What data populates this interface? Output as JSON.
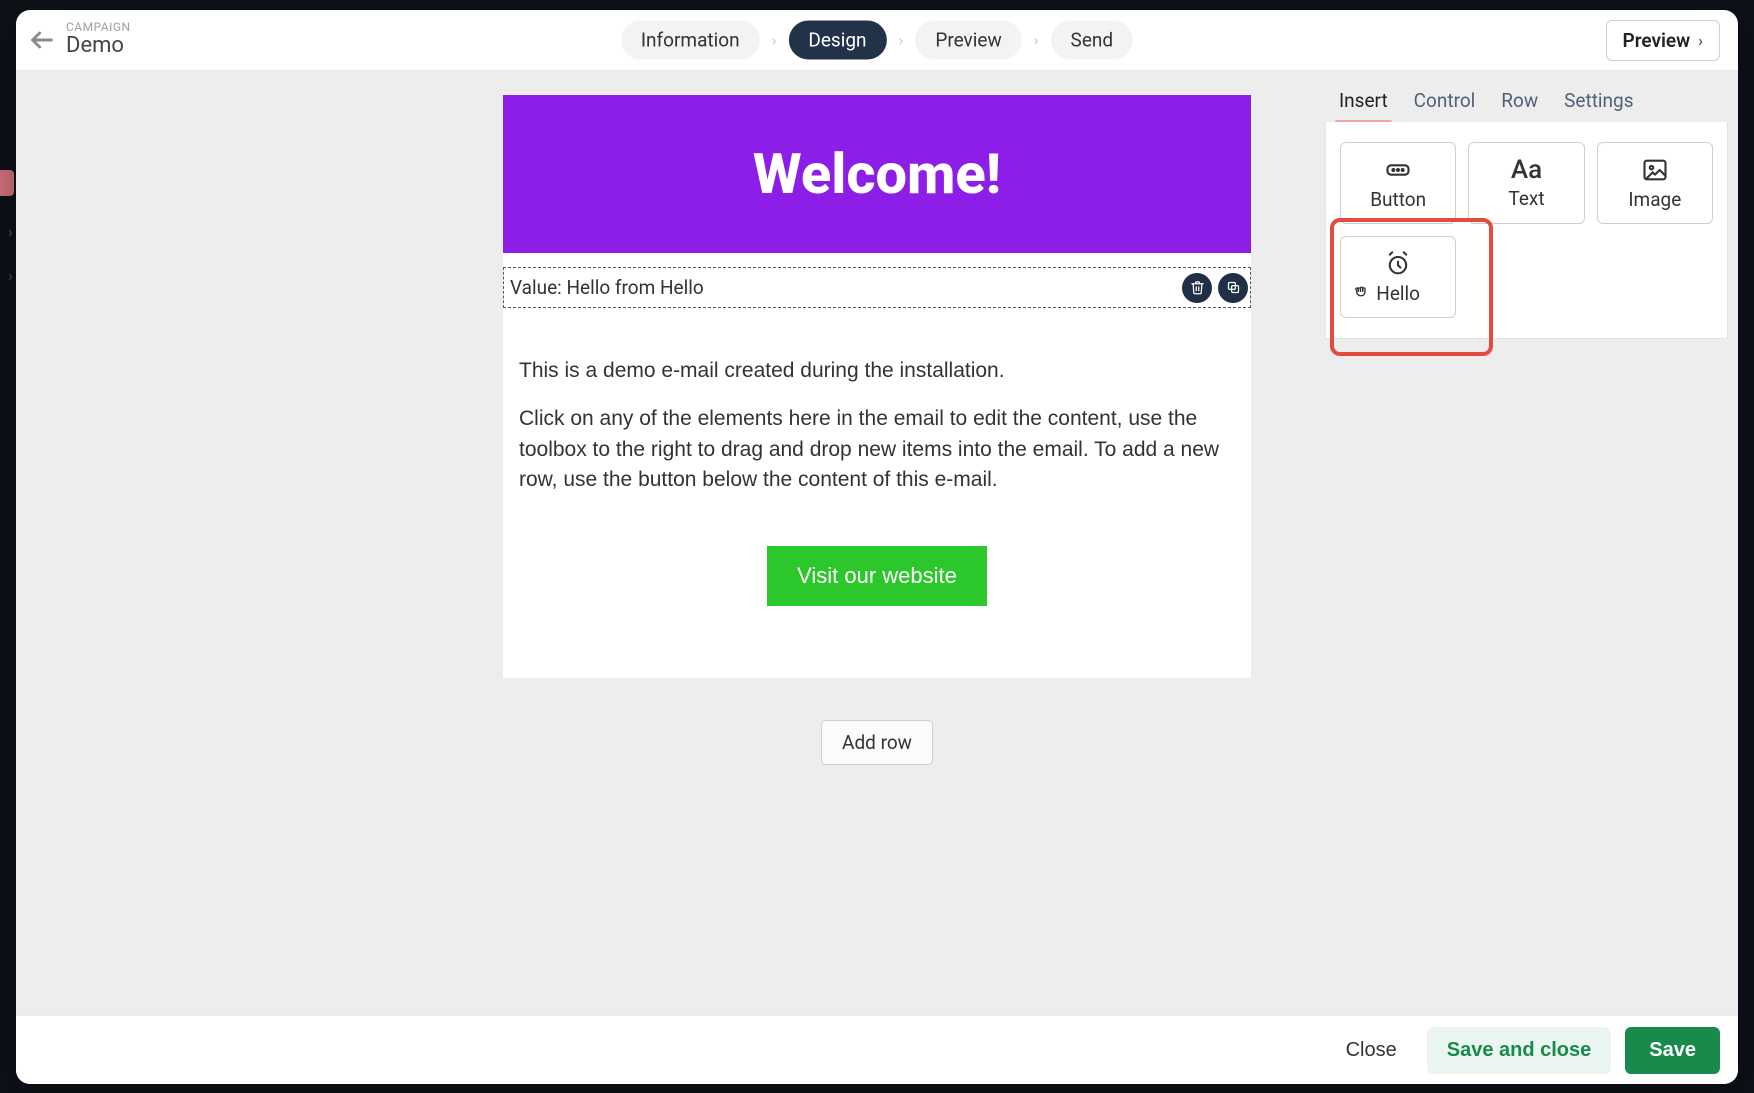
{
  "header": {
    "overline": "CAMPAIGN",
    "title": "Demo",
    "steps": [
      "Information",
      "Design",
      "Preview",
      "Send"
    ],
    "active_step_index": 1,
    "preview_button": "Preview"
  },
  "email": {
    "hero_title": "Welcome!",
    "hero_bg_color": "#8d1ee8",
    "selected_block_text": "Value: Hello from Hello",
    "paragraph_1": "This is a demo e-mail created during the installation.",
    "paragraph_2": "Click on any of the elements here in the email to edit the content, use the toolbox to the right to drag and drop new items into the email. To add a new row, use the button below the content of this e-mail.",
    "cta_label": "Visit our website",
    "cta_bg_color": "#2bc72b",
    "add_row_label": "Add row"
  },
  "right_panel": {
    "tabs": [
      "Insert",
      "Control",
      "Row",
      "Settings"
    ],
    "active_tab_index": 0,
    "blocks": [
      {
        "name": "Button",
        "icon": "button-icon"
      },
      {
        "name": "Text",
        "icon": "text-icon"
      },
      {
        "name": "Image",
        "icon": "image-icon"
      },
      {
        "name": "Hello",
        "icon": "clock-icon"
      }
    ],
    "highlighted_block_index": 3
  },
  "footer": {
    "close": "Close",
    "save_and_close": "Save and close",
    "save": "Save"
  }
}
